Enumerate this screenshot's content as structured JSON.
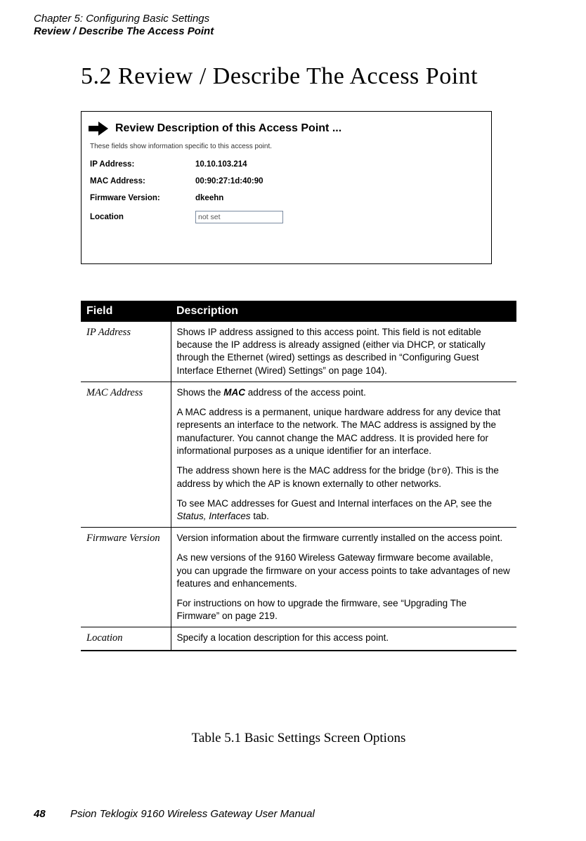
{
  "header": {
    "chapter": "Chapter 5:  Configuring Basic Settings",
    "section": "Review / Describe The Access Point"
  },
  "heading": "5.2  Review / Describe The Access Point",
  "screenshot": {
    "title": "Review Description of this Access Point ...",
    "subtitle": "These fields show information specific to this access point.",
    "ip_label": "IP Address:",
    "ip_value": "10.10.103.214",
    "mac_label": "MAC Address:",
    "mac_value": "00:90:27:1d:40:90",
    "fw_label": "Firmware Version:",
    "fw_value": "dkeehn",
    "loc_label": "Location",
    "loc_value": "not set"
  },
  "table": {
    "header_field": "Field",
    "header_desc": "Description",
    "rows": [
      {
        "field": "IP Address",
        "desc_p1": "Shows IP address assigned to this access point. This field is not editable because the IP address is already assigned (either via DHCP, or statically through the Ethernet (wired) settings as described in “Configuring Guest Interface Ethernet (Wired) Settings” on page 104)."
      },
      {
        "field": "MAC Address",
        "desc_p1_prefix": "Shows the ",
        "desc_p1_bold": "MAC",
        "desc_p1_suffix": " address of the access point.",
        "desc_p2": "A MAC address is a permanent, unique hardware address for any device that represents an interface to the network. The MAC address is assigned by the manufacturer. You cannot change the MAC address. It is provided here for informational purposes as a unique identifier for an interface.",
        "desc_p3_prefix": "The address shown here is the MAC address for the bridge (",
        "desc_p3_mono": "br0",
        "desc_p3_suffix": "). This is the address by which the AP is known externally to other networks.",
        "desc_p4_prefix": "To see MAC addresses for Guest and Internal interfaces on the AP, see the ",
        "desc_p4_italic": "Status, Interfaces",
        "desc_p4_suffix": " tab."
      },
      {
        "field": "Firmware Version",
        "desc_p1": "Version information about the firmware currently installed on the access point.",
        "desc_p2": "As new versions of the 9160 Wireless Gateway firmware become available, you can upgrade the firmware on your access points to take advantages of new features and enhancements.",
        "desc_p3": "For instructions on how to upgrade the firmware, see “Upgrading The Firmware” on page 219."
      },
      {
        "field": "Location",
        "desc_p1": "Specify a location description for this access point."
      }
    ],
    "caption": "Table 5.1 Basic Settings Screen Options"
  },
  "footer": {
    "page": "48",
    "manual": "Psion Teklogix 9160 Wireless Gateway User Manual"
  }
}
